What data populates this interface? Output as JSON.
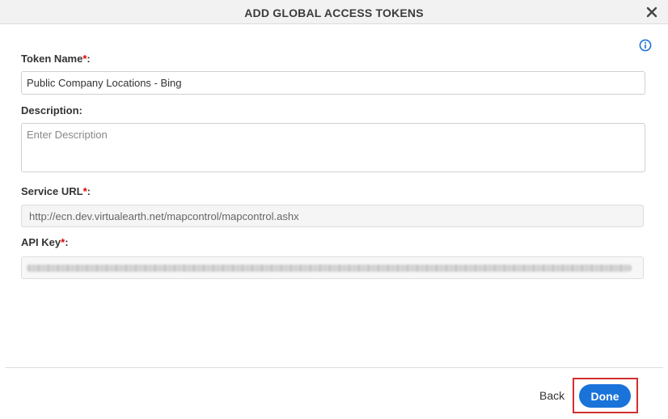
{
  "dialog": {
    "title": "ADD GLOBAL ACCESS TOKENS",
    "close_icon": "close-icon",
    "info_icon": "info-icon"
  },
  "form": {
    "token_name": {
      "label": "Token Name",
      "required_mark": "*",
      "suffix": ":",
      "value": "Public Company Locations - Bing"
    },
    "description": {
      "label": "Description:",
      "value": "",
      "placeholder": "Enter Description"
    },
    "service_url": {
      "label": "Service URL",
      "required_mark": "*",
      "suffix": ":",
      "value": "http://ecn.dev.virtualearth.net/mapcontrol/mapcontrol.ashx"
    },
    "api_key": {
      "label": "API Key",
      "required_mark": "*",
      "suffix": ":"
    }
  },
  "footer": {
    "back_label": "Back",
    "done_label": "Done"
  },
  "colors": {
    "accent": "#1a73d9",
    "required": "#e00000",
    "highlight": "#d32f2f"
  }
}
